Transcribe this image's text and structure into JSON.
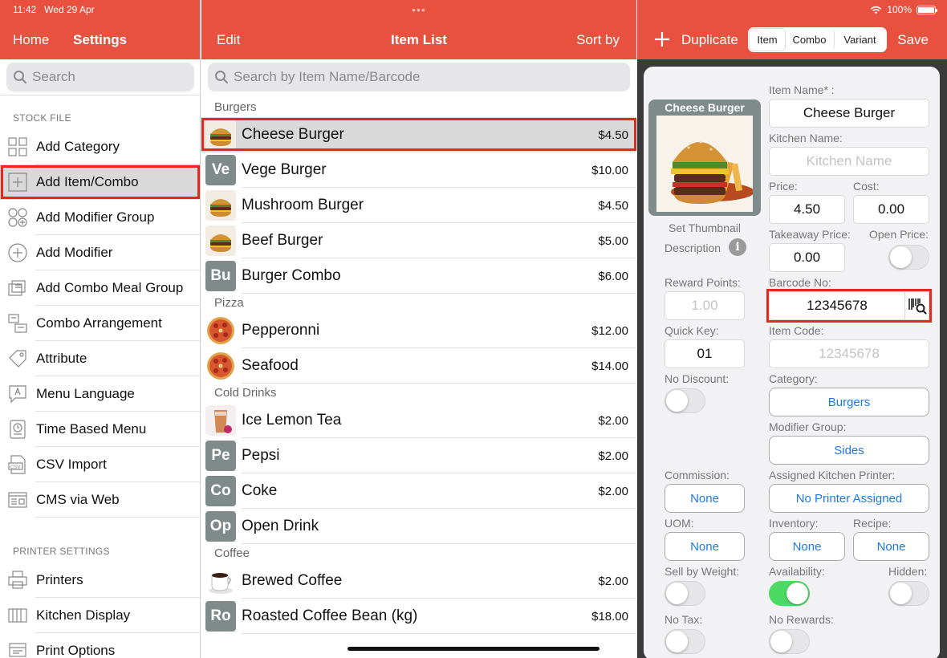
{
  "status_bar": {
    "time": "11:42",
    "date": "Wed 29 Apr",
    "battery": "100%"
  },
  "left_panel": {
    "nav": {
      "home": "Home",
      "title": "Settings"
    },
    "search_placeholder": "Search",
    "stock_header": "STOCK FILE",
    "stock_items": [
      {
        "label": "Add Category",
        "icon": "grid-icon"
      },
      {
        "label": "Add Item/Combo",
        "icon": "plus-square-icon"
      },
      {
        "label": "Add Modifier Group",
        "icon": "circles-icon"
      },
      {
        "label": "Add Modifier",
        "icon": "plus-circle-icon"
      },
      {
        "label": "Add Combo Meal Group",
        "icon": "combo-icon"
      },
      {
        "label": "Combo Arrangement",
        "icon": "arrange-icon"
      },
      {
        "label": "Attribute",
        "icon": "tag-icon"
      },
      {
        "label": "Menu Language",
        "icon": "language-icon"
      },
      {
        "label": "Time Based Menu",
        "icon": "clock-doc-icon"
      },
      {
        "label": "CSV Import",
        "icon": "csv-icon"
      },
      {
        "label": "CMS via Web",
        "icon": "browser-icon"
      }
    ],
    "printer_header": "PRINTER SETTINGS",
    "printer_items": [
      {
        "label": "Printers",
        "icon": "printer-icon"
      },
      {
        "label": "Kitchen Display",
        "icon": "kitchen-display-icon"
      },
      {
        "label": "Print Options",
        "icon": "print-options-icon"
      }
    ]
  },
  "middle_panel": {
    "nav": {
      "edit": "Edit",
      "title": "Item List",
      "sort": "Sort by"
    },
    "search_placeholder": "Search by Item Name/Barcode",
    "groups": [
      {
        "name": "Burgers",
        "items": [
          {
            "name": "Cheese Burger",
            "price": "$4.50",
            "thumb": "burger",
            "abbr": ""
          },
          {
            "name": "Vege Burger",
            "price": "$10.00",
            "thumb": "",
            "abbr": "Ve"
          },
          {
            "name": "Mushroom Burger",
            "price": "$4.50",
            "thumb": "burger",
            "abbr": ""
          },
          {
            "name": "Beef Burger",
            "price": "$5.00",
            "thumb": "burger",
            "abbr": ""
          },
          {
            "name": "Burger Combo",
            "price": "$6.00",
            "thumb": "",
            "abbr": "Bu"
          }
        ]
      },
      {
        "name": "Pizza",
        "items": [
          {
            "name": "Pepperonni",
            "price": "$12.00",
            "thumb": "pizza",
            "abbr": ""
          },
          {
            "name": "Seafood",
            "price": "$14.00",
            "thumb": "pizza",
            "abbr": ""
          }
        ]
      },
      {
        "name": "Cold Drinks",
        "items": [
          {
            "name": "Ice Lemon Tea",
            "price": "$2.00",
            "thumb": "drink",
            "abbr": ""
          },
          {
            "name": "Pepsi",
            "price": "$2.00",
            "thumb": "",
            "abbr": "Pe"
          },
          {
            "name": "Coke",
            "price": "$2.00",
            "thumb": "",
            "abbr": "Co"
          },
          {
            "name": "Open Drink",
            "price": "",
            "thumb": "",
            "abbr": "Op"
          }
        ]
      },
      {
        "name": "Coffee",
        "items": [
          {
            "name": "Brewed Coffee",
            "price": "$2.00",
            "thumb": "coffee",
            "abbr": ""
          },
          {
            "name": "Roasted Coffee Bean (kg)",
            "price": "$18.00",
            "thumb": "",
            "abbr": "Ro"
          }
        ]
      }
    ]
  },
  "right_panel": {
    "nav": {
      "duplicate": "Duplicate",
      "save": "Save"
    },
    "segments": [
      "Item",
      "Combo",
      "Variant"
    ],
    "thumbnail": {
      "caption": "Cheese Burger",
      "set_label": "Set Thumbnail",
      "description_label": "Description"
    },
    "fields": {
      "item_name_label": "Item Name* :",
      "item_name": "Cheese Burger",
      "kitchen_name_label": "Kitchen Name:",
      "kitchen_name_placeholder": "Kitchen Name",
      "price_label": "Price:",
      "price": "4.50",
      "cost_label": "Cost:",
      "cost": "0.00",
      "takeaway_label": "Takeaway Price:",
      "takeaway": "0.00",
      "open_price_label": "Open Price:",
      "reward_label": "Reward Points:",
      "reward_placeholder": "1.00",
      "barcode_label": "Barcode No:",
      "barcode": "12345678",
      "quick_key_label": "Quick Key:",
      "quick_key": "01",
      "item_code_label": "Item Code:",
      "item_code_placeholder": "12345678",
      "no_discount_label": "No Discount:",
      "category_label": "Category:",
      "category": "Burgers",
      "modifier_label": "Modifier Group:",
      "modifier": "Sides",
      "commission_label": "Commission:",
      "commission": "None",
      "printer_label": "Assigned Kitchen Printer:",
      "printer": "No Printer Assigned",
      "uom_label": "UOM:",
      "uom": "None",
      "inventory_label": "Inventory:",
      "inventory": "None",
      "recipe_label": "Recipe:",
      "recipe": "None",
      "weight_label": "Sell by Weight:",
      "availability_label": "Availability:",
      "hidden_label": "Hidden:",
      "no_tax_label": "No Tax:",
      "no_rewards_label": "No Rewards:"
    },
    "toggles": {
      "open_price": false,
      "no_discount": false,
      "sell_by_weight": false,
      "availability": true,
      "hidden": false,
      "no_tax": false,
      "no_rewards": false
    }
  },
  "colors": {
    "brand": "#e8503f",
    "link": "#1f7ae0",
    "highlight": "#e8261c",
    "toggle_on": "#4cd964"
  }
}
